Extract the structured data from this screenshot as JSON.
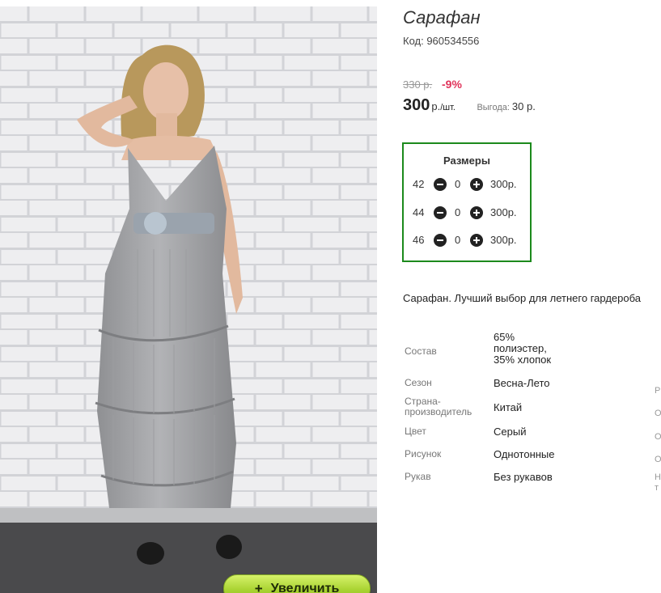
{
  "product": {
    "title": "Сарафан",
    "code": "Код: 960534556",
    "old_price": "330 р.",
    "discount": "-9%",
    "price": "300",
    "price_unit": "р.",
    "unit_per": "/шт.",
    "benefit_label": "Выгода:",
    "benefit_value": "30 р."
  },
  "photo": {
    "zoom_button": {
      "icon": "plus-icon",
      "label": "Увеличить"
    }
  },
  "sizes": {
    "title": "Размеры",
    "rows": [
      {
        "size": "42",
        "qty": "0",
        "price": "300р."
      },
      {
        "size": "44",
        "qty": "0",
        "price": "300р."
      },
      {
        "size": "46",
        "qty": "0",
        "price": "300р."
      }
    ]
  },
  "description": "Сарафан. Лучший выбор для летнего гардероба",
  "attributes": [
    {
      "label": "Состав",
      "value": "65% полиэстер, 35% хлопок"
    },
    {
      "label": "Сезон",
      "value": "Весна-Лето"
    },
    {
      "label": "Страна-производитель",
      "value": "Китай"
    },
    {
      "label": "Цвет",
      "value": "Серый"
    },
    {
      "label": "Рисунок",
      "value": "Однотонные"
    },
    {
      "label": "Рукав",
      "value": "Без рукавов"
    }
  ],
  "cut_off_column": [
    "Р",
    "О",
    "О",
    "О",
    "Н",
    "т"
  ],
  "colors": {
    "discount": "#e0335a",
    "sizes_border": "#1c8a1c",
    "zoom_button": "#a9d332"
  }
}
